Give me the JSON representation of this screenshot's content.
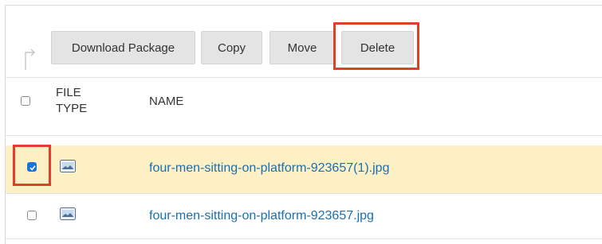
{
  "toolbar": {
    "download_label": "Download Package",
    "copy_label": "Copy",
    "move_label": "Move",
    "delete_label": "Delete"
  },
  "table": {
    "col_file_type_line1": "FILE",
    "col_file_type_line2": "TYPE",
    "col_name": "NAME",
    "rows": [
      {
        "name": "four-men-sitting-on-platform-923657(1).jpg",
        "checked": true
      },
      {
        "name": "four-men-sitting-on-platform-923657.jpg",
        "checked": false
      }
    ]
  },
  "colors": {
    "highlight": "#e0402a",
    "selected_row_bg": "#fdf0c4",
    "link": "#1a6fb3",
    "button_bg": "#e4e4e4"
  },
  "icons": {
    "toolbar_arrow": "return-arrow-icon",
    "file_type": "image-file-icon"
  }
}
